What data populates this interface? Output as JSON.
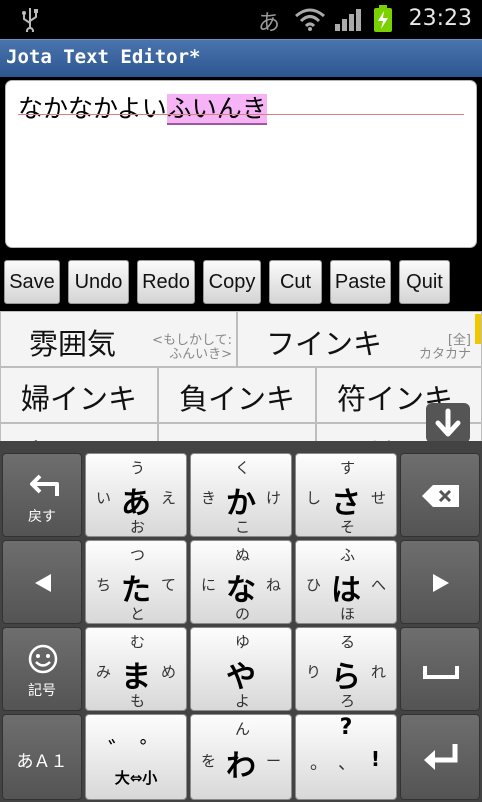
{
  "status_bar": {
    "ime_indicator": "あ",
    "time": "23:23"
  },
  "titlebar": {
    "title": "Jota Text Editor*"
  },
  "editor": {
    "committed_text": "なかなかよい",
    "composing_text": "ふいんき"
  },
  "toolbar": {
    "buttons": [
      "Save",
      "Undo",
      "Redo",
      "Copy",
      "Cut",
      "Paste",
      "Quit"
    ]
  },
  "candidates": {
    "row1": [
      {
        "text": "雰囲気",
        "note1": "<もしかして:",
        "note2": "ふんいき>"
      },
      {
        "text": "フインキ",
        "note1": "[全]",
        "note2": "カタカナ"
      }
    ],
    "row2": [
      "婦インキ",
      "負インキ",
      "符インキ"
    ],
    "row3": [
      "腐インキ",
      "ふいんき",
      "ふ付"
    ]
  },
  "keyboard": {
    "left_col": {
      "back_label": "戻す",
      "symbol_label": "記号",
      "mode_label": "あＡ１"
    },
    "keys": [
      {
        "main": "あ",
        "top": "う",
        "left": "い",
        "right": "え",
        "bottom": "お"
      },
      {
        "main": "か",
        "top": "く",
        "left": "き",
        "right": "け",
        "bottom": "こ"
      },
      {
        "main": "さ",
        "top": "す",
        "left": "し",
        "right": "せ",
        "bottom": "そ"
      },
      {
        "main": "た",
        "top": "つ",
        "left": "ち",
        "right": "て",
        "bottom": "と"
      },
      {
        "main": "な",
        "top": "ぬ",
        "left": "に",
        "right": "ね",
        "bottom": "の"
      },
      {
        "main": "は",
        "top": "ふ",
        "left": "ひ",
        "right": "へ",
        "bottom": "ほ"
      },
      {
        "main": "ま",
        "top": "む",
        "left": "み",
        "right": "め",
        "bottom": "も"
      },
      {
        "main": "や",
        "top": "ゆ",
        "left": "",
        "right": "",
        "bottom": "よ"
      },
      {
        "main": "ら",
        "top": "る",
        "left": "り",
        "right": "れ",
        "bottom": "ろ"
      },
      {
        "main": "わ",
        "top": "ん",
        "left": "を",
        "right": "ー",
        "bottom": ""
      }
    ],
    "dakuten_key": {
      "marks": "゛ ゜",
      "label": "大⇔小"
    },
    "punct_key": {
      "top": "?",
      "left": "。",
      "mid": "、",
      "right": "!"
    }
  },
  "colors": {
    "titlebar": "#3b66a0",
    "composing_bg": "#f6b3f5",
    "keyboard_bg": "#434343"
  }
}
